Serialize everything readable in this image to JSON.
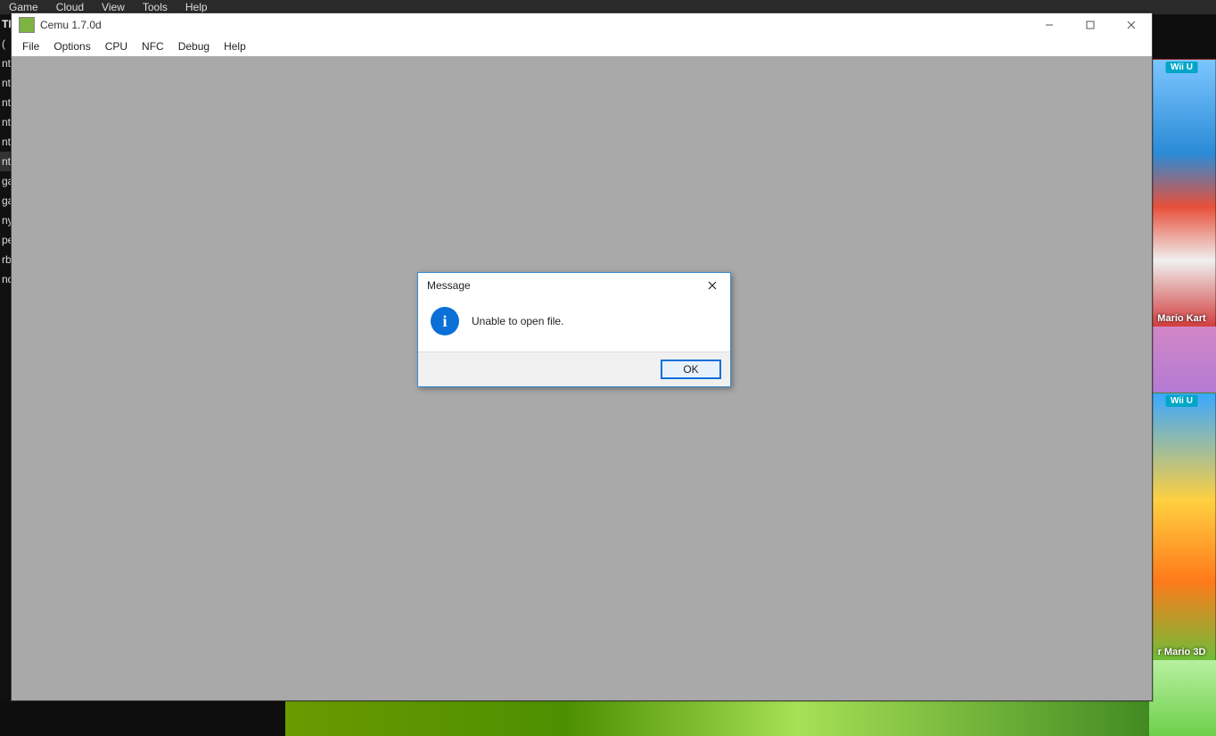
{
  "bg_app": {
    "menu": [
      "Game",
      "Cloud",
      "View",
      "Tools",
      "Help"
    ],
    "list_header": "TFC",
    "list_items": [
      "(",
      "nt",
      "nt",
      "nt",
      "nt",
      "nt",
      "nt",
      "ga",
      "ga",
      "ny",
      "pe",
      "rb",
      "nd"
    ],
    "active_index": 6,
    "tiles": {
      "badge": "Wii U",
      "title1": "Mario Kart",
      "title2": "r Mario 3D"
    }
  },
  "cemu": {
    "title": "Cemu 1.7.0d",
    "menu": [
      "File",
      "Options",
      "CPU",
      "NFC",
      "Debug",
      "Help"
    ]
  },
  "dialog": {
    "title": "Message",
    "text": "Unable to open file.",
    "ok": "OK"
  }
}
